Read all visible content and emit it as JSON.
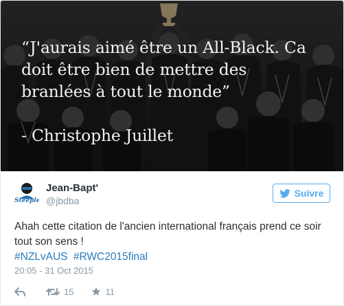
{
  "photo": {
    "quote_lines": "“J'aurais aimé être un All-Black. Ca\ndoit être bien de mettre des\nbranlées à tout le monde”",
    "author": "- Christophe Juillet"
  },
  "user": {
    "display_name": "Jean-Bapt'",
    "handle": "@jbdba",
    "avatar_caption": "Steeple"
  },
  "follow_button": {
    "label": "Suivre"
  },
  "tweet": {
    "text": "Ahah cette citation de l'ancien international français prend ce soir tout son sens !",
    "hashtags": [
      "#NZLvAUS",
      "#RWC2015final"
    ],
    "timestamp": "20:05 - 31 Oct 2015"
  },
  "actions": {
    "retweet_count": "15",
    "like_count": "11"
  },
  "colors": {
    "accent": "#55acee",
    "hashtag": "#2b7bb9",
    "muted": "#8899a6",
    "text": "#292f33"
  }
}
